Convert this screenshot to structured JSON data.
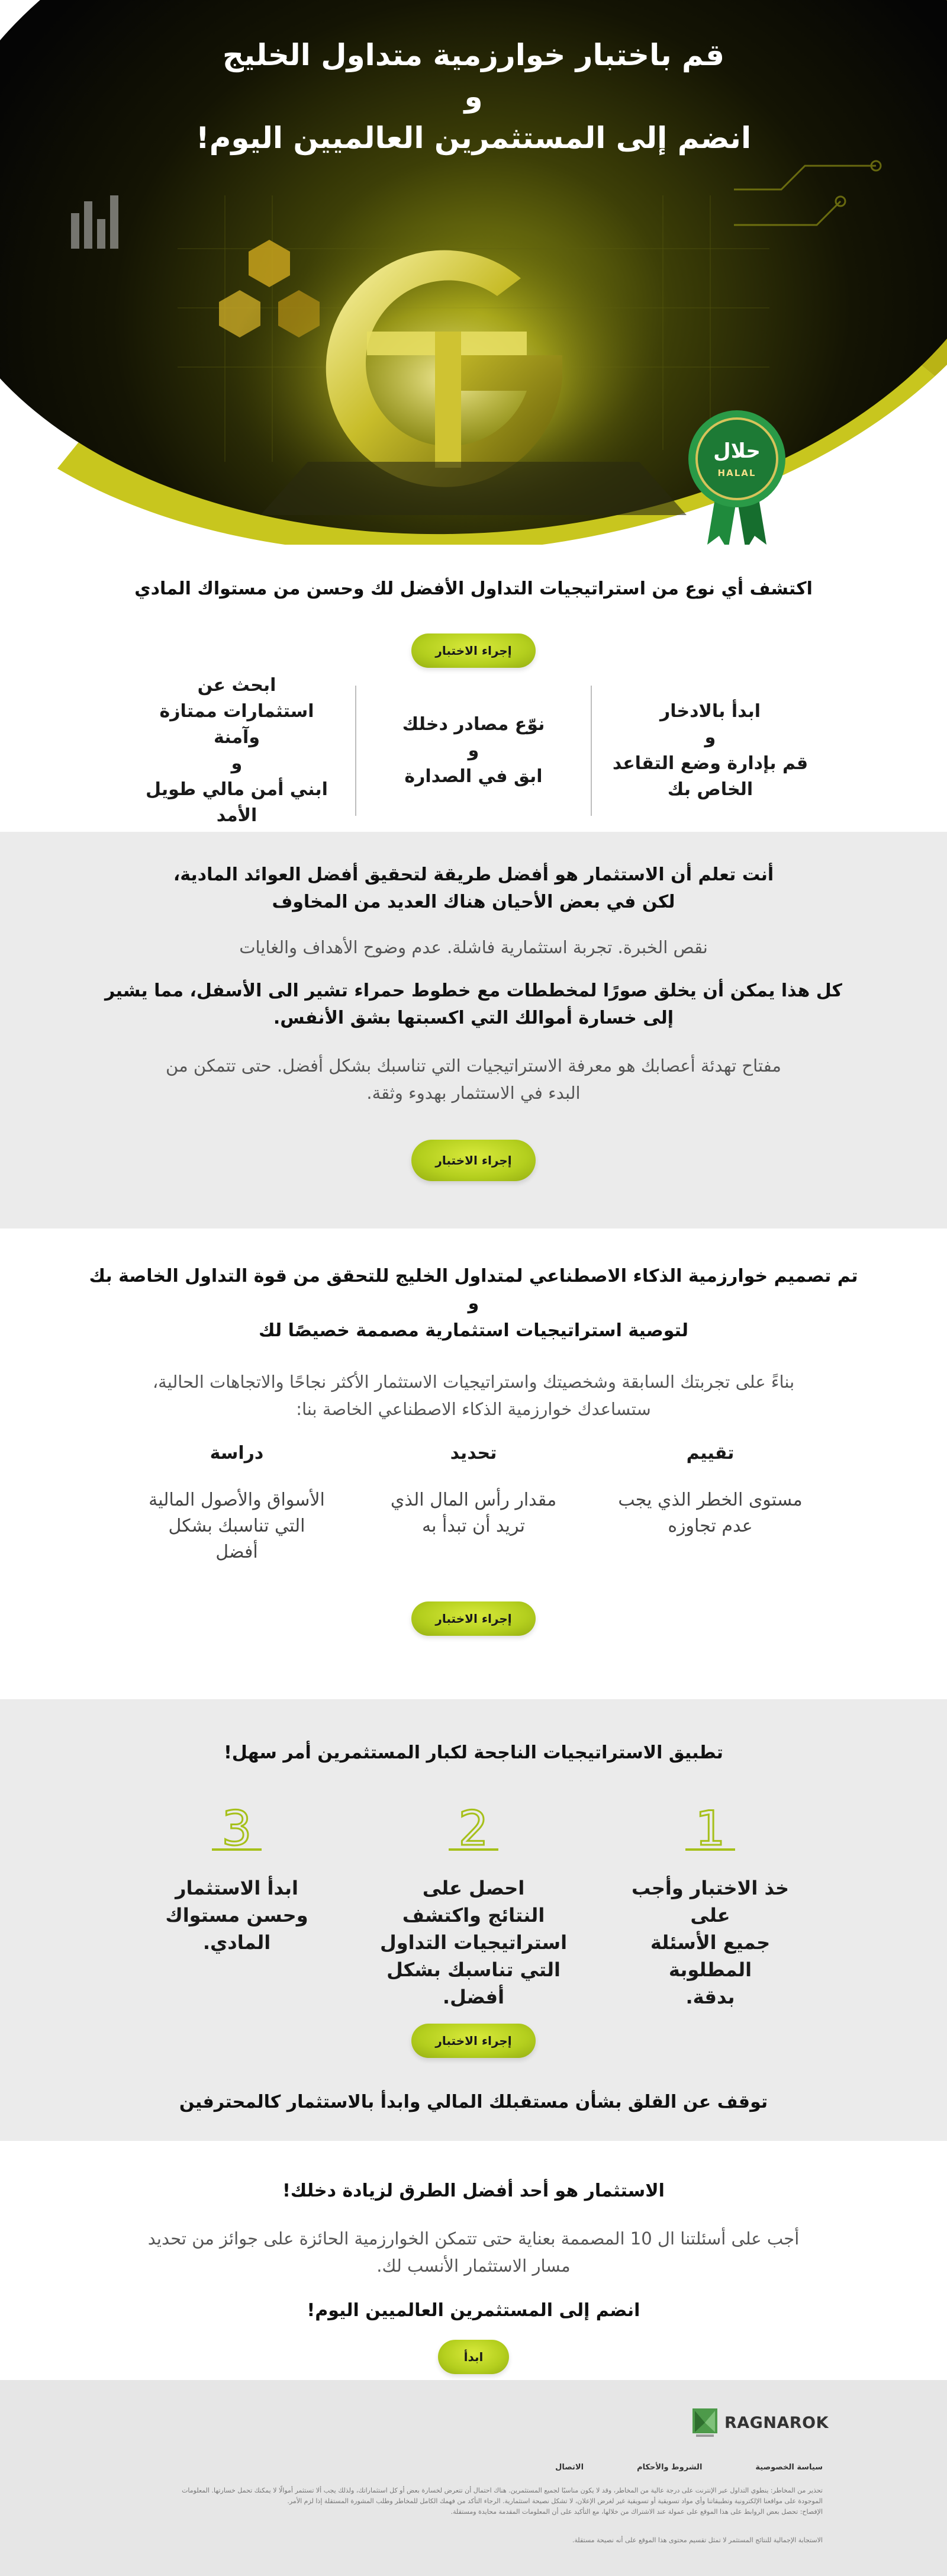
{
  "hero": {
    "title_line1": "قم باختبار خوارزمية متداول الخليج",
    "title_line2": "و",
    "title_line3": "انضم إلى المستثمرين العالميين اليوم!",
    "badge_arabic": "حلال",
    "badge_english": "HALAL",
    "logo_letter": "G"
  },
  "intro": {
    "headline": "اكتشف أي نوع من استراتيجيات التداول الأفضل لك وحسن من مستواك المادي",
    "button": "إجراء الاختبار",
    "columns": [
      {
        "line1": "ابدأ بالادخار",
        "line2": "و",
        "line3": "قم بإدارة وضع التقاعد",
        "line4": "الخاص بك"
      },
      {
        "line1": "نوّع مصادر دخلك",
        "line2": "و",
        "line3": "ابق في الصدارة"
      },
      {
        "line1": "ابحث عن",
        "line2": "استثمارات ممتازة وآمنة",
        "line3": "و",
        "line4": "ابني أمن مالي طويل",
        "line5": "الأمد"
      }
    ]
  },
  "fears": {
    "headline_line1": "أنت تعلم أن الاستثمار هو أفضل طريقة لتحقيق أفضل العوائد المادية،",
    "headline_line2": "لكن في بعض الأحيان هناك العديد من المخاوف",
    "subtitle": "نقص الخبرة. تجربة استثمارية فاشلة. عدم وضوح الأهداف والغايات",
    "warning_line1": "كل هذا يمكن أن يخلق صورًا لمخططات مع خطوط حمراء تشير الى الأسفل، مما يشير",
    "warning_line2": "إلى خسارة أموالك التي اكسبتها بشق الأنفس.",
    "key_line1": "مفتاح تهدئة أعصابك هو معرفة الاستراتيجيات التي تناسبك بشكل أفضل. حتى تتمكن من",
    "key_line2": "البدء في الاستثمار بهدوء وثقة.",
    "button": "إجراء الاختبار"
  },
  "ai": {
    "headline_line1": "تم تصميم خوارزمية الذكاء الاصطناعي لمتداول الخليج للتحقق من قوة التداول الخاصة بك",
    "headline_line2": "و",
    "headline_line3": "لتوصية استراتيجيات استثمارية مصممة خصيصًا لك",
    "body_line1": "بناءً على تجربتك السابقة وشخصيتك واستراتيجيات الاستثمار الأكثر نجاحًا والاتجاهات الحالية،",
    "body_line2": "ستساعدك خوارزمية الذكاء الاصطناعي الخاصة بنا:",
    "columns": [
      {
        "title": "تقييم",
        "line1": "مستوى الخطر الذي يجب",
        "line2": "عدم تجاوزه"
      },
      {
        "title": "تحديد",
        "line1": "مقدار رأس المال الذي",
        "line2": "تريد أن تبدأ به"
      },
      {
        "title": "دراسة",
        "line1": "الأسواق والأصول المالية",
        "line2": "التي تناسبك بشكل",
        "line3": "أفضل"
      }
    ],
    "button": "إجراء الاختبار"
  },
  "steps": {
    "headline": "تطبيق الاستراتيجيات الناجحة لكبار المستثمرين أمر سهل!",
    "items": [
      {
        "number": "1",
        "line1": "خذ الاختبار وأجب على",
        "line2": "جميع الأسئلة المطلوبة",
        "line3": "بدقة."
      },
      {
        "number": "2",
        "line1": "احصل على",
        "line2": "النتائج واكتشف",
        "line3": "استراتيجيات التداول",
        "line4": "التي تناسبك بشكل",
        "line5": "أفضل."
      },
      {
        "number": "3",
        "line1": "ابدأ الاستثمار",
        "line2": "وحسن مستواك",
        "line3": "المادي."
      }
    ],
    "button": "إجراء الاختبار",
    "closing": "توقف عن القلق بشأن مستقبلك المالي وابدأ بالاستثمار كالمحترفين"
  },
  "join": {
    "headline": "الاستثمار هو أحد أفضل الطرق لزيادة دخلك!",
    "body_line1": "أجب على أسئلتنا ال 10 المصممة بعناية حتى تتمكن الخوارزمية الحائزة على جوائز من تحديد",
    "body_line2": "مسار الاستثمار الأنسب لك.",
    "cta": "انضم إلى المستثمرين العالميين اليوم!",
    "button": "ابدأ"
  },
  "footer": {
    "logo_text": "RAGNAROK",
    "links": [
      "سياسة الخصوصية",
      "الشروط والأحكام",
      "الاتصال"
    ],
    "legal_line1": "تحذير من المخاطر: ينطوي التداول عبر الإنترنت على درجة عالية من المخاطر، وقد لا يكون مناسبًا لجميع المستثمرين. هناك احتمال أن تتعرض لخسارة بعض أو كل استثماراتك، ولذلك يجب ألا تستثمر أموالًا لا يمكنك تحمل خسارتها. المعلومات",
    "legal_line2": "الموجودة على مواقعنا الإلكترونية وتطبيقاتنا وأي مواد تسويقية أو تسويقية غير لغرض الإعلان، لا تشكل نصيحة استثمارية. الرجاء التأكد من فهمك الكامل للمخاطر وطلب المشورة المستقلة إذا لزم الأمر.",
    "legal_line3": "الإفصاح: تحصل بعض الروابط على هذا الموقع على عمولة عند الاشتراك من خلالها، مع التأكيد على أن المعلومات المقدمة محايدة ومستقلة.",
    "legal_line4": "الاستجابة الإجمالية للنتائج المستثمر لا تمثل تقسيم محتوى هذا الموقع على أنه نصيحة مستقلة."
  },
  "colors": {
    "accent": "#b4cf1e",
    "accent_dark": "#94ad12",
    "step_numbers": "#a6c01a",
    "gray_band": "#ebebeb",
    "hero_dark": "#050505"
  }
}
